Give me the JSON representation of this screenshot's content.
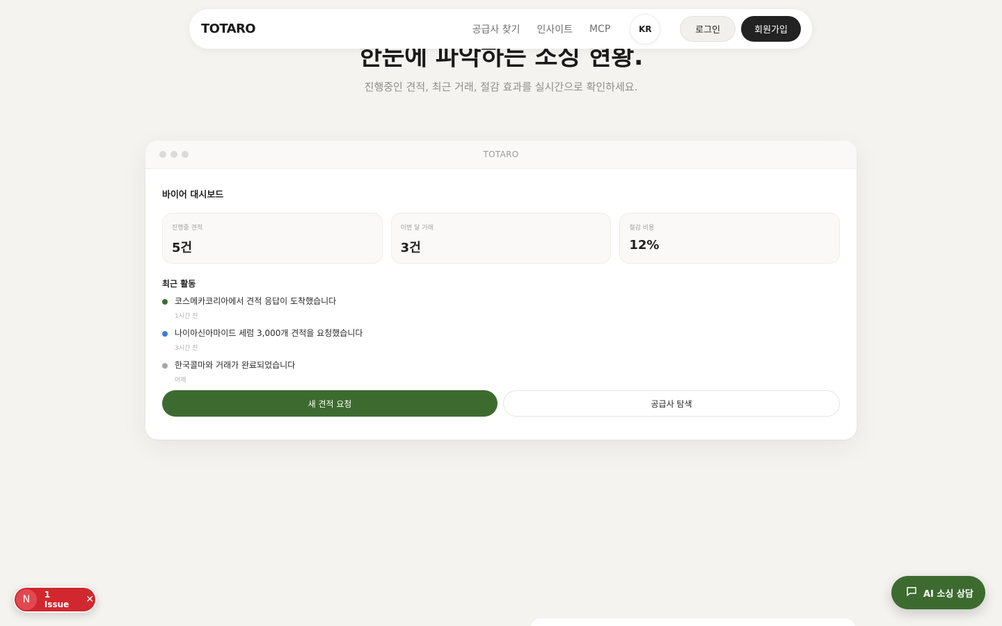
{
  "hero": {
    "title": "한눈에 파악하는 소싱 현황.",
    "subtitle": "진행중인 견적, 최근 거래, 절감 효과를 실시간으로 확인하세요."
  },
  "nav": {
    "logo": "TOTARO",
    "links": [
      "공급사 찾기",
      "인사이트",
      "MCP"
    ],
    "lang": "KR",
    "login": "로그인",
    "signup": "회원가입"
  },
  "card": {
    "window_title": "TOTARO",
    "dashboard_title": "바이어 대시보드",
    "stats": [
      {
        "label": "진행중 견적",
        "value": "5건"
      },
      {
        "label": "이번 달 거래",
        "value": "3건"
      },
      {
        "label": "절감 비용",
        "value": "12%"
      }
    ],
    "activity_title": "최근 활동",
    "activities": [
      {
        "text": "코스메카코리아에서 견적 응답이 도착했습니다",
        "time": "1시간 전",
        "color": "#3d6b2f"
      },
      {
        "text": "나이아신아마이드 세럼 3,000개 견적을 요청했습니다",
        "time": "3시간 전",
        "color": "#3b7bdb"
      },
      {
        "text": "한국콜마와 거래가 완료되었습니다",
        "time": "어제",
        "color": "#a5a5a5"
      }
    ],
    "primary_action": "새 견적 요청",
    "secondary_action": "공급사 탐색"
  },
  "issue_badge": {
    "logo": "N",
    "text": "1 Issue",
    "close": "✕"
  },
  "ai_button": {
    "label": "AI 소싱 상담",
    "icon": "chat-bubble-icon"
  },
  "colors": {
    "background": "#f5f3ef",
    "brand_green": "#3d6b2f",
    "issue_red": "#d0282e"
  }
}
